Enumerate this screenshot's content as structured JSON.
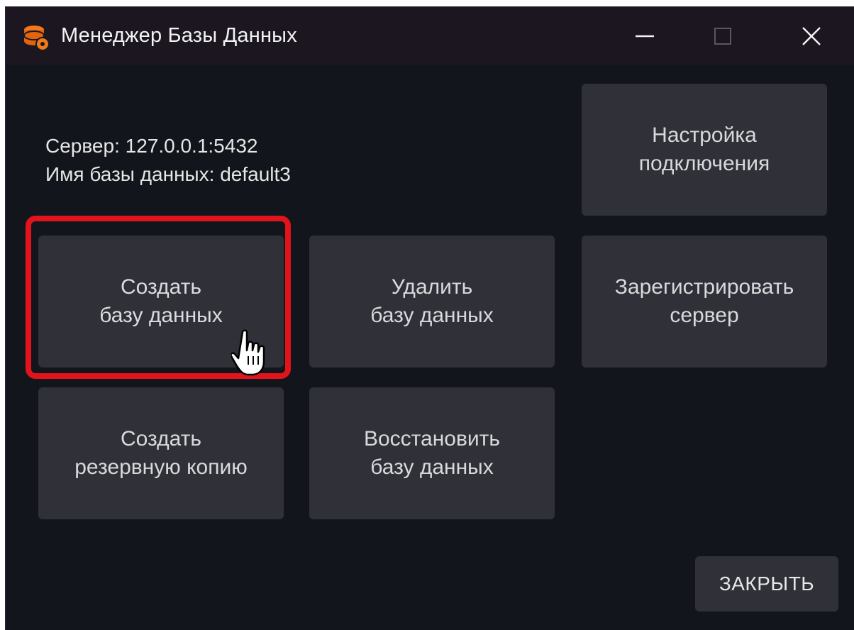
{
  "window": {
    "title": "Менеджер Базы Данных",
    "controls": {
      "minimize": "minimize",
      "maximize": "maximize",
      "close": "close"
    }
  },
  "info": {
    "server": "Сервер: 127.0.0.1:5432",
    "database": "Имя базы данных: default3"
  },
  "buttons": {
    "connection_settings": [
      "Настройка",
      "подключения"
    ],
    "create_db": [
      "Создать",
      "базу данных"
    ],
    "delete_db": [
      "Удалить",
      "базу данных"
    ],
    "register_server": [
      "Зарегистрировать",
      "сервер"
    ],
    "backup": [
      "Создать",
      "резервную копию"
    ],
    "restore_db": [
      "Восстановить",
      "базу данных"
    ],
    "close": "ЗАКРЫТЬ"
  },
  "colors": {
    "window_bg": "#13151c",
    "titlebar_bg": "#1b1620",
    "tile_bg": "#2f3038",
    "highlight": "#e0141a",
    "accent_icon": "#f07a1a"
  },
  "icons": {
    "app": "database-wrench-icon",
    "cursor": "hand-pointer-icon"
  }
}
